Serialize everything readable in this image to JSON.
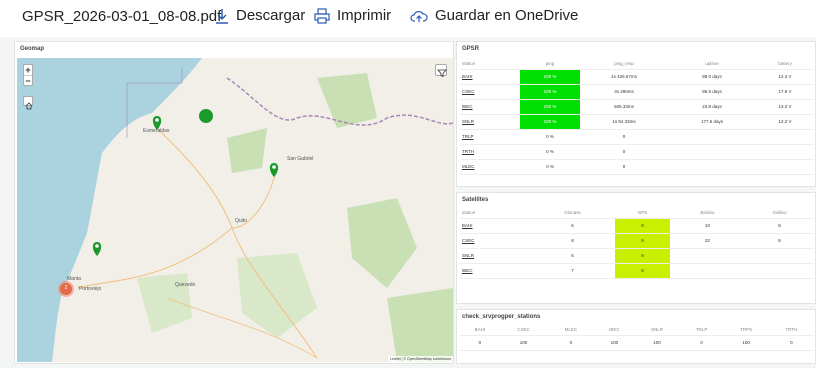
{
  "toolbar": {
    "filename": "GPSR_2026-03-01_08-08.pdf",
    "download_label": "Descargar",
    "print_label": "Imprimir",
    "onedrive_label": "Guardar en OneDrive"
  },
  "geomap": {
    "title": "Geomap",
    "zoom_in": "+",
    "zoom_out": "−",
    "attribution": "Leaflet | © OpenStreetMap contributors",
    "cluster_count": "2",
    "cities": [
      "Esmeraldas",
      "San Gabriel",
      "Quito",
      "Manta",
      "Portoviejo",
      "Quevedo"
    ]
  },
  "gpsr": {
    "title": "GPSR",
    "headers": [
      "station",
      "ping",
      "ping_resp",
      "uptime",
      "battery"
    ],
    "rows": [
      [
        "BAHI",
        "100 %",
        "1s 426.67ms",
        "88.0 days",
        "12.3 V"
      ],
      [
        "CSEC",
        "100 %",
        "3s 290ms",
        "86.5 days",
        "17.6 V"
      ],
      [
        "IBEC",
        "100 %",
        "505.33ms",
        "23.8 days",
        "13.2 V"
      ],
      [
        "SNLR",
        "100 %",
        "1s 84.33ms",
        "177.6 days",
        "12.2 V"
      ],
      [
        "TRLP",
        "0 %",
        "0",
        "",
        ""
      ],
      [
        "TRTH",
        "0 %",
        "0",
        "",
        ""
      ],
      [
        "MLEC",
        "0 %",
        "0",
        "",
        ""
      ]
    ]
  },
  "satellites": {
    "title": "Satellites",
    "headers": [
      "station",
      "Glonass",
      "GPS",
      "Beidou",
      "Galileo"
    ],
    "rows": [
      [
        "BAHI",
        "6",
        "9",
        "10",
        "8"
      ],
      [
        "CSEC",
        "8",
        "9",
        "32",
        "8"
      ],
      [
        "SNLR",
        "6",
        "9",
        "",
        ""
      ],
      [
        "IBEC",
        "7",
        "8",
        "",
        ""
      ]
    ]
  },
  "srv": {
    "title": "check_srvprogper_stations",
    "headers": [
      "BAHI",
      "CSEC",
      "MLEC",
      "IBEC",
      "SNLR",
      "TRLP",
      "TRPS",
      "TRTH"
    ],
    "values": [
      "0",
      "100",
      "0",
      "100",
      "100",
      "0",
      "100",
      "0"
    ]
  }
}
